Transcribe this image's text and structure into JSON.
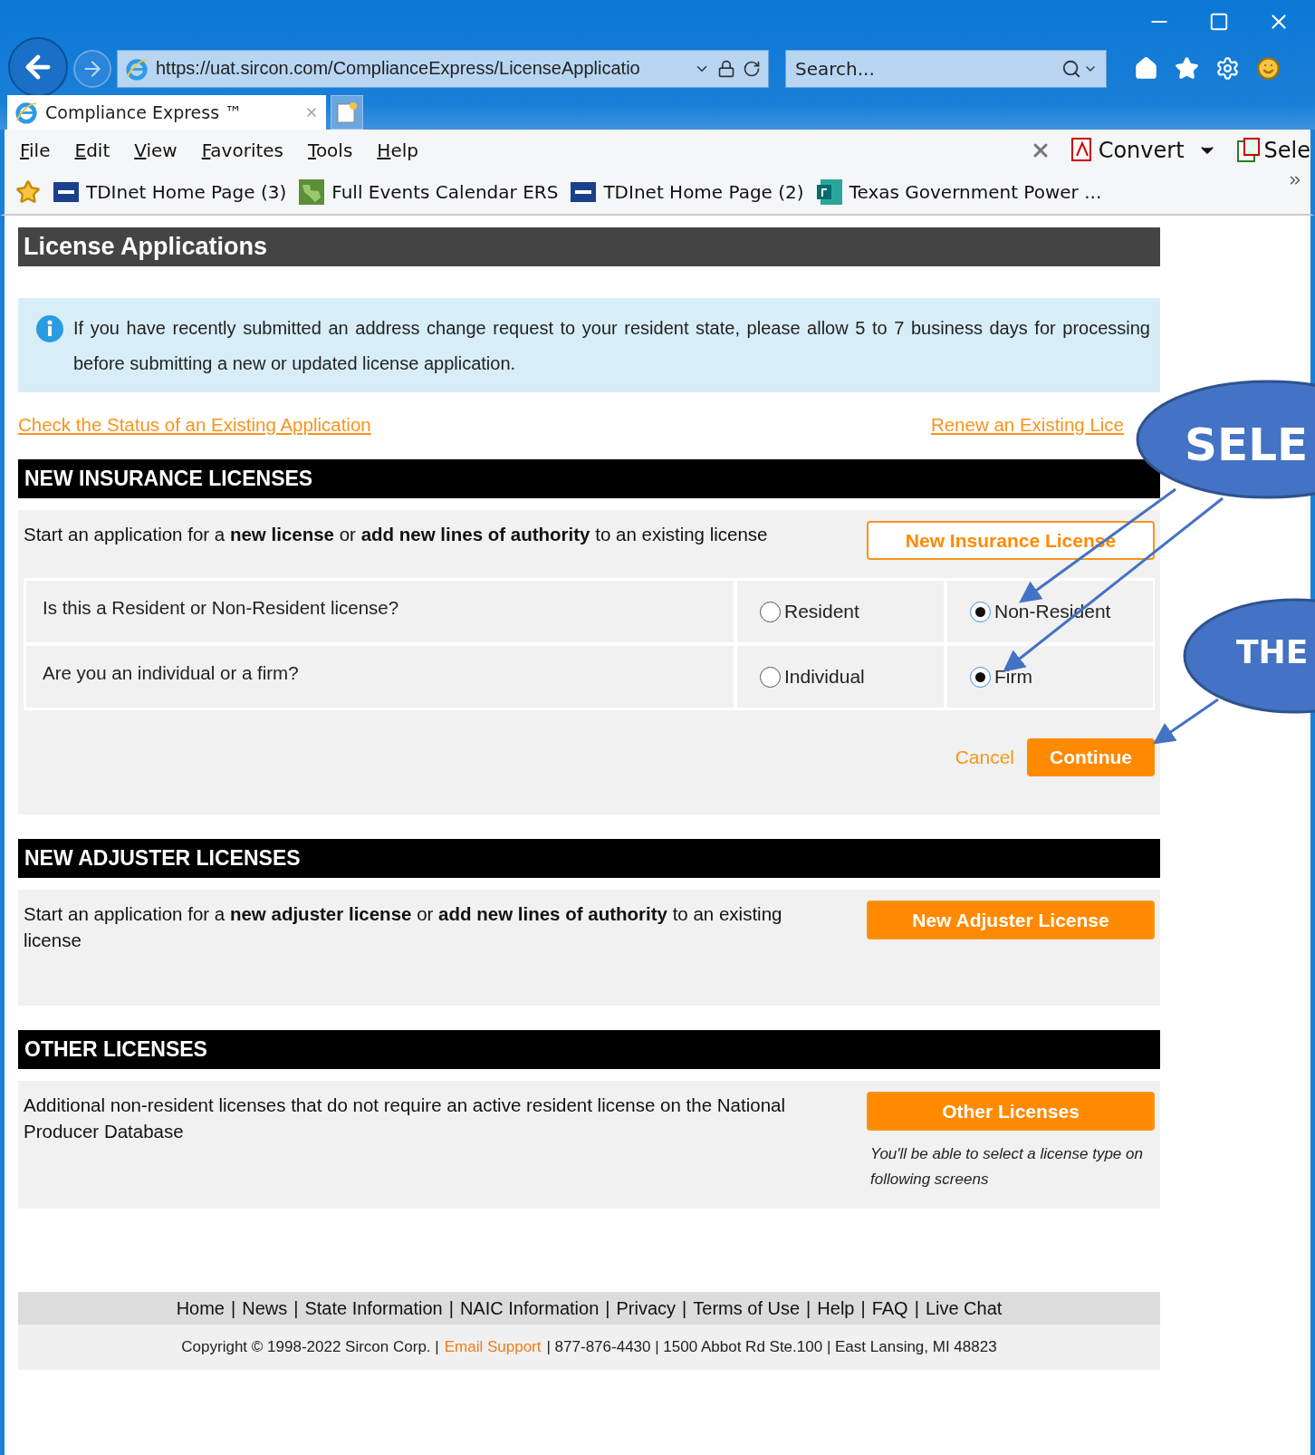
{
  "browser": {
    "address": "https://uat.sircon.com/ComplianceExpress/LicenseApplicatio",
    "search": {
      "placeholder": "Search..."
    },
    "tab": {
      "title": "Compliance Express ™"
    },
    "menu": [
      "File",
      "Edit",
      "View",
      "Favorites",
      "Tools",
      "Help"
    ],
    "toolbar": [
      {
        "kind": "pdf",
        "label": "Convert"
      },
      {
        "kind": "select",
        "label": "Sele"
      }
    ],
    "favorites": [
      {
        "kind": "tdi",
        "label": "TDInet Home Page (3)"
      },
      {
        "kind": "map",
        "label": "Full Events Calendar  ERS"
      },
      {
        "kind": "tdi",
        "label": "TDInet Home Page (2)"
      },
      {
        "kind": "forms",
        "label": "Texas Government Power ..."
      }
    ]
  },
  "page": {
    "title": "License Applications",
    "notice": "If you have recently submitted an address change request to your resident state, please allow 5 to 7 business days for processing before submitting a new or updated license application.",
    "links": [
      "Check the Status of an Existing Application",
      "Renew an Existing Lice"
    ],
    "sections": [
      {
        "heading": "NEW INSURANCE LICENSES",
        "text": "Start an application for a **new license** or **add new lines of authority** to an existing license",
        "button": {
          "label": "New Insurance License",
          "outlined": true
        },
        "questions": [
          {
            "label": "Is this a Resident or Non-Resident license?",
            "options": [
              {
                "label": "Resident",
                "selected": false
              },
              {
                "label": "Non-Resident",
                "selected": true
              }
            ]
          },
          {
            "label": "Are you an individual or a firm?",
            "options": [
              {
                "label": "Individual",
                "selected": false
              },
              {
                "label": "Firm",
                "selected": true
              }
            ]
          }
        ],
        "actions": {
          "cancel": "Cancel",
          "continue": "Continue"
        }
      },
      {
        "heading": "NEW ADJUSTER LICENSES",
        "text": "Start an application for a **new adjuster license** or **add new lines of authority** to an existing license",
        "button": {
          "label": "New Adjuster License",
          "outlined": false
        }
      },
      {
        "heading": "OTHER LICENSES",
        "text": "Additional non-resident licenses that do not require an active resident license on the National Producer Database",
        "button": {
          "label": "Other Licenses",
          "outlined": false
        },
        "hint": "You'll be able to select a license type on following screens"
      }
    ],
    "footer": {
      "links": [
        "Home",
        "News",
        "State Information",
        "NAIC Information",
        "Privacy",
        "Terms of Use",
        "Help",
        "FAQ",
        "Live Chat"
      ],
      "separator": "|",
      "copyright": "Copyright © 1998-2022 Sircon Corp. |",
      "email": "Email Support",
      "contact": "| 877-876-4430 | 1500 Abbot Rd Ste.100 | East Lansing, MI 48823"
    }
  },
  "callouts": [
    {
      "text": "SELE"
    },
    {
      "text": "THE"
    }
  ]
}
